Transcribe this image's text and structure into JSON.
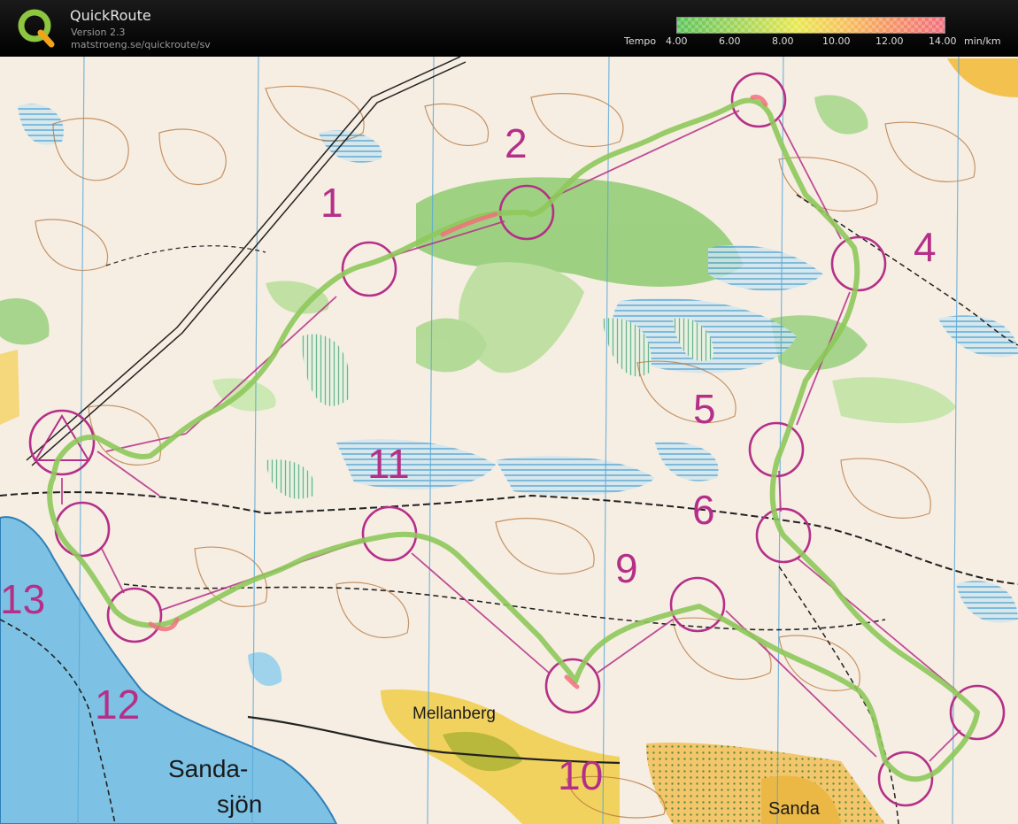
{
  "app": {
    "name": "QuickRoute",
    "version": "Version 2.3",
    "url": "matstroeng.se/quickroute/sv"
  },
  "legend": {
    "label": "Tempo",
    "unit": "min/km",
    "ticks": [
      "4.00",
      "6.00",
      "8.00",
      "10.00",
      "12.00",
      "14.00"
    ],
    "colors": [
      "#5ec45a",
      "#a9d65a",
      "#e9e84f",
      "#f6c35a",
      "#f59466",
      "#f2707e"
    ]
  },
  "map": {
    "place_names": [
      "Mellanberg",
      "Sanda-",
      "sjön",
      "Sanda"
    ],
    "control_numbers": [
      "1",
      "2",
      "4",
      "5",
      "6",
      "9",
      "10",
      "11",
      "12",
      "13"
    ],
    "course_color": "#b52f88",
    "route_color": "#8ec85a"
  }
}
